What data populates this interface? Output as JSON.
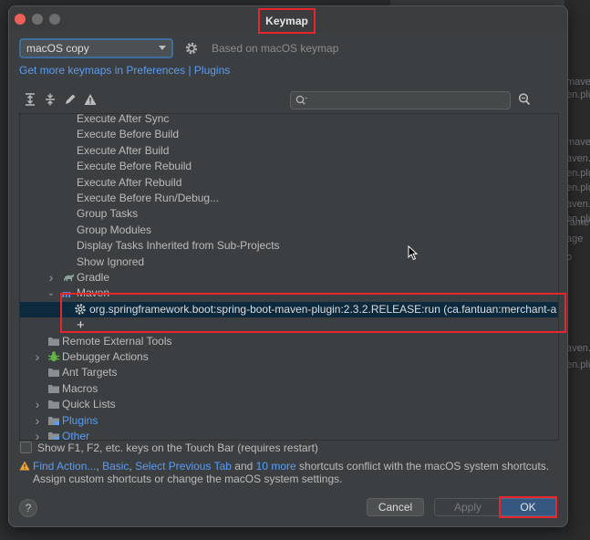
{
  "dialog": {
    "title": "Keymap"
  },
  "keymap": {
    "selected": "macOS copy",
    "based_on": "Based on macOS keymap",
    "get_more_prefix": "Get more keymaps in",
    "preferences_link": "Preferences",
    "separator": "|",
    "plugins_link": "Plugins"
  },
  "toolbar": {
    "icons": [
      "expand-all-icon",
      "collapse-all-icon",
      "edit-icon",
      "warning-filter-icon"
    ],
    "search_value": "",
    "search_placeholder": ""
  },
  "tree": {
    "items": [
      {
        "label": "Execute After Sync",
        "level": 3,
        "icon": "none"
      },
      {
        "label": "Execute Before Build",
        "level": 3,
        "icon": "none"
      },
      {
        "label": "Execute After Build",
        "level": 3,
        "icon": "none"
      },
      {
        "label": "Execute Before Rebuild",
        "level": 3,
        "icon": "none"
      },
      {
        "label": "Execute After Rebuild",
        "level": 3,
        "icon": "none"
      },
      {
        "label": "Execute Before Run/Debug...",
        "level": 3,
        "icon": "none"
      },
      {
        "label": "Group Tasks",
        "level": 3,
        "icon": "none"
      },
      {
        "label": "Group Modules",
        "level": 3,
        "icon": "none"
      },
      {
        "label": "Display Tasks Inherited from Sub-Projects",
        "level": 3,
        "icon": "none"
      },
      {
        "label": "Show Ignored",
        "level": 3,
        "icon": "none"
      },
      {
        "label": "Gradle",
        "level": 2,
        "icon": "gradle-icon",
        "arrow": "collapsed"
      },
      {
        "label": "Maven",
        "level": 2,
        "icon": "maven-icon",
        "arrow": "expanded"
      },
      {
        "label": "org.springframework.boot:spring-boot-maven-plugin:2.3.2.RELEASE:run (ca.fantuan:merchant-a",
        "level": 3,
        "icon": "gear-icon",
        "selected": true
      },
      {
        "label": "+",
        "level": 3,
        "icon": "none"
      },
      {
        "label": "Remote External Tools",
        "level": 1,
        "icon": "folder-icon"
      },
      {
        "label": "Debugger Actions",
        "level": 1,
        "icon": "bug-icon",
        "arrow": "collapsed"
      },
      {
        "label": "Ant Targets",
        "level": 1,
        "icon": "folder-icon"
      },
      {
        "label": "Macros",
        "level": 1,
        "icon": "folder-icon"
      },
      {
        "label": "Quick Lists",
        "level": 1,
        "icon": "folder-icon",
        "arrow": "collapsed"
      },
      {
        "label": "Plugins",
        "level": 1,
        "icon": "folder-icon",
        "arrow": "collapsed",
        "blue": true
      },
      {
        "label": "Other",
        "level": 1,
        "icon": "folder-icon",
        "arrow": "collapsed",
        "blue": true
      }
    ]
  },
  "touchbar_label": "Show F1, F2, etc. keys on the Touch Bar (requires restart)",
  "warning": {
    "link_find_action": "Find Action...",
    "comma1": ",",
    "link_basic": "Basic",
    "comma2": ",",
    "link_select_prev_tab": "Select Previous Tab",
    "and": "and",
    "link_more": "10 more",
    "text_rest": "shortcuts conflict with the macOS system shortcuts. Assign custom shortcuts or change the macOS system settings."
  },
  "buttons": {
    "help": "?",
    "cancel": "Cancel",
    "apply": "Apply",
    "ok": "OK"
  },
  "background_fragments": [
    "maven",
    "en.plu",
    "maven",
    "aven.pl",
    "en.plu",
    "en.plugi",
    "aven.pl",
    "en.plu",
    "ramew",
    "age",
    "o",
    "aven.",
    "en.plug"
  ],
  "colors": {
    "accent": "#589df6",
    "highlight": "#e8242c",
    "ok": "#365880"
  }
}
